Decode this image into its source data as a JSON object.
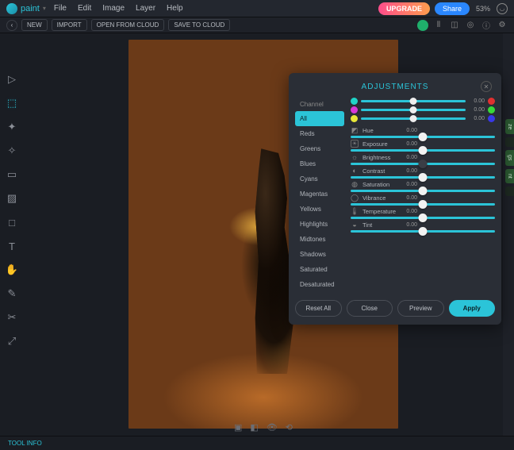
{
  "menubar": {
    "app_name": "paint",
    "items": [
      "File",
      "Edit",
      "Image",
      "Layer",
      "Help"
    ],
    "upgrade": "UPGRADE",
    "share": "Share",
    "zoom": "53%"
  },
  "actionbar": {
    "new": "NEW",
    "import": "IMPORT",
    "open_cloud": "OPEN FROM CLOUD",
    "save_cloud": "SAVE TO CLOUD"
  },
  "panel": {
    "title": "ADJUSTMENTS",
    "channel_label": "Channel",
    "channels": [
      "All",
      "Reds",
      "Greens",
      "Blues",
      "Cyans",
      "Magentas",
      "Yellows",
      "Highlights",
      "Midtones",
      "Shadows",
      "Saturated",
      "Desaturated"
    ],
    "color_rows": [
      {
        "left": "#1fd4c8",
        "right": "#e03030",
        "val": "0.00"
      },
      {
        "left": "#d838d8",
        "right": "#38d838",
        "val": "0.00"
      },
      {
        "left": "#e8e838",
        "right": "#3838e8",
        "val": "0.00"
      }
    ],
    "sliders": [
      {
        "icon": "◩",
        "name": "Hue",
        "val": "0.00"
      },
      {
        "icon": "☀",
        "name": "Exposure",
        "val": "0.00",
        "boxed": true
      },
      {
        "icon": "☼",
        "name": "Brightness",
        "val": "0.00",
        "dark_thumb": true
      },
      {
        "icon": "◐",
        "name": "Contrast",
        "val": "0.00"
      },
      {
        "icon": "◍",
        "name": "Saturation",
        "val": "0.00"
      },
      {
        "icon": "◯",
        "name": "Vibrance",
        "val": "0.00"
      },
      {
        "icon": "🌡",
        "name": "Temperature",
        "val": "0.00"
      },
      {
        "icon": "◒",
        "name": "Tint",
        "val": "0.00"
      }
    ],
    "buttons": {
      "reset": "Reset All",
      "close": "Close",
      "preview": "Preview",
      "apply": "Apply"
    }
  },
  "status": {
    "tool_info": "TOOL INFO"
  },
  "edge_tabs": [
    "ze",
    "",
    "gs",
    "nt",
    ""
  ]
}
